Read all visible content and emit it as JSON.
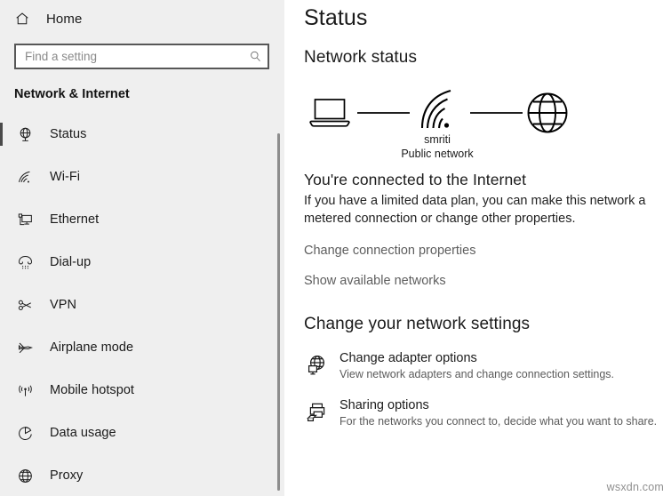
{
  "sidebar": {
    "home": {
      "label": "Home",
      "icon": "home-icon"
    },
    "search": {
      "value": "",
      "placeholder": "Find a setting",
      "icon": "search-icon"
    },
    "category_title": "Network & Internet",
    "items": [
      {
        "label": "Status",
        "icon": "network-status-icon",
        "selected": true
      },
      {
        "label": "Wi-Fi",
        "icon": "wifi-icon",
        "selected": false
      },
      {
        "label": "Ethernet",
        "icon": "ethernet-icon",
        "selected": false
      },
      {
        "label": "Dial-up",
        "icon": "dialup-phone-icon",
        "selected": false
      },
      {
        "label": "VPN",
        "icon": "vpn-key-icon",
        "selected": false
      },
      {
        "label": "Airplane mode",
        "icon": "airplane-icon",
        "selected": false
      },
      {
        "label": "Mobile hotspot",
        "icon": "hotspot-icon",
        "selected": false
      },
      {
        "label": "Data usage",
        "icon": "pie-chart-icon",
        "selected": false
      },
      {
        "label": "Proxy",
        "icon": "globe-icon",
        "selected": false
      }
    ]
  },
  "main": {
    "page_title": "Status",
    "network_status_heading": "Network status",
    "diagram": {
      "device_icon": "laptop-icon",
      "signal_icon": "wifi-signal-icon",
      "internet_icon": "globe-icon",
      "network_name": "smriti",
      "network_type": "Public network"
    },
    "connection_headline": "You're connected to the Internet",
    "connection_description": "If you have a limited data plan, you can make this network a metered connection or change other properties.",
    "links": [
      {
        "label": "Change connection properties"
      },
      {
        "label": "Show available networks"
      }
    ],
    "settings_heading": "Change your network settings",
    "options": [
      {
        "title": "Change adapter options",
        "description": "View network adapters and change connection settings.",
        "icon": "adapter-globe-monitor-icon"
      },
      {
        "title": "Sharing options",
        "description": "For the networks you connect to, decide what you want to share.",
        "icon": "sharing-printer-icon"
      }
    ]
  },
  "watermark": "wsxdn.com"
}
